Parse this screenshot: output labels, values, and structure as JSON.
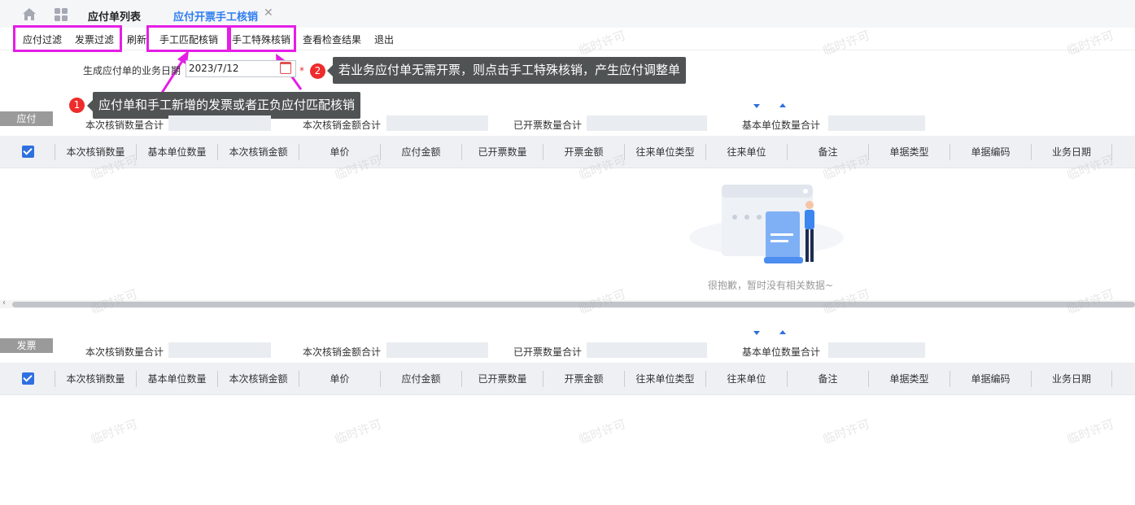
{
  "tabs": {
    "home_icon": "home-icon",
    "grid_icon": "grid-icon",
    "tab1": "应付单列表",
    "tab2": "应付开票手工核销",
    "close": "✕"
  },
  "toolbar": {
    "buttons": [
      "应付过滤",
      "发票过滤",
      "刷新",
      "手工匹配核销",
      "手工特殊核销",
      "查看检查结果",
      "退出"
    ]
  },
  "form": {
    "date_label": "生成应付单的业务日期",
    "date_value": "2023/7/12",
    "required": "*"
  },
  "annotations": {
    "a1_num": "1",
    "a1_text": "应付单和手工新增的发票或者正负应付匹配核销",
    "a2_num": "2",
    "a2_text": "若业务应付单无需开票，则点击手工特殊核销，产生应付调整单"
  },
  "sections": {
    "payable": "应付",
    "invoice": "发票"
  },
  "sums": [
    "本次核销数量合计",
    "本次核销金额合计",
    "已开票数量合计",
    "基本单位数量合计"
  ],
  "columns": [
    "本次核销数量",
    "基本单位数量",
    "本次核销金额",
    "单价",
    "应付金额",
    "已开票数量",
    "开票金额",
    "往来单位类型",
    "往来单位",
    "备注",
    "单据类型",
    "单据编码",
    "业务日期"
  ],
  "empty": {
    "text": "很抱歉，暂时没有相关数据~"
  },
  "watermark": "临时许可",
  "colors": {
    "accent": "#2f7df0",
    "highlight": "#e51ee5",
    "annotation_bg": "#505354",
    "annotation_badge": "#ee2c2c"
  }
}
